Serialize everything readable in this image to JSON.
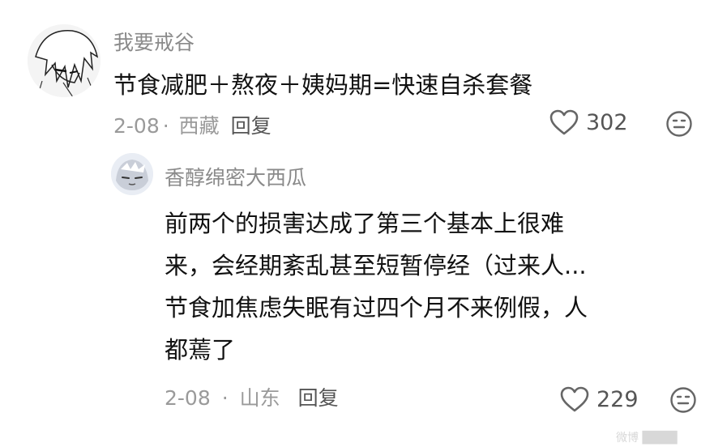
{
  "comments": [
    {
      "username": "我要戒谷",
      "text": "节食减肥＋熬夜＋姨妈期=快速自杀套餐",
      "date": "2-08",
      "sep": "·",
      "location": "西藏",
      "reply_label": "回复",
      "likes": "302",
      "avatar_icon": "anime-white-hair-avatar-icon",
      "reaction_icon": "neutral-face-icon"
    },
    {
      "username": "香醇绵密大西瓜",
      "text_lines": [
        "前两个的损害达成了第三个基本上很难",
        "来，会经期紊乱甚至短暂停经（过来人...",
        "节食加焦虑失眠有过四个月不来例假，人",
        "都蔫了"
      ],
      "date": "2-08",
      "sep": "·",
      "location": "山东",
      "reply_label": "回复",
      "likes": "229",
      "avatar_icon": "sleepy-cartoon-avatar-icon",
      "reaction_icon": "neutral-face-icon"
    }
  ],
  "colors": {
    "username": "#8a8a8a",
    "text": "#111111",
    "meta": "#9a9a9a",
    "reply": "#555555",
    "icon": "#666666"
  },
  "watermark": "微博 ████"
}
